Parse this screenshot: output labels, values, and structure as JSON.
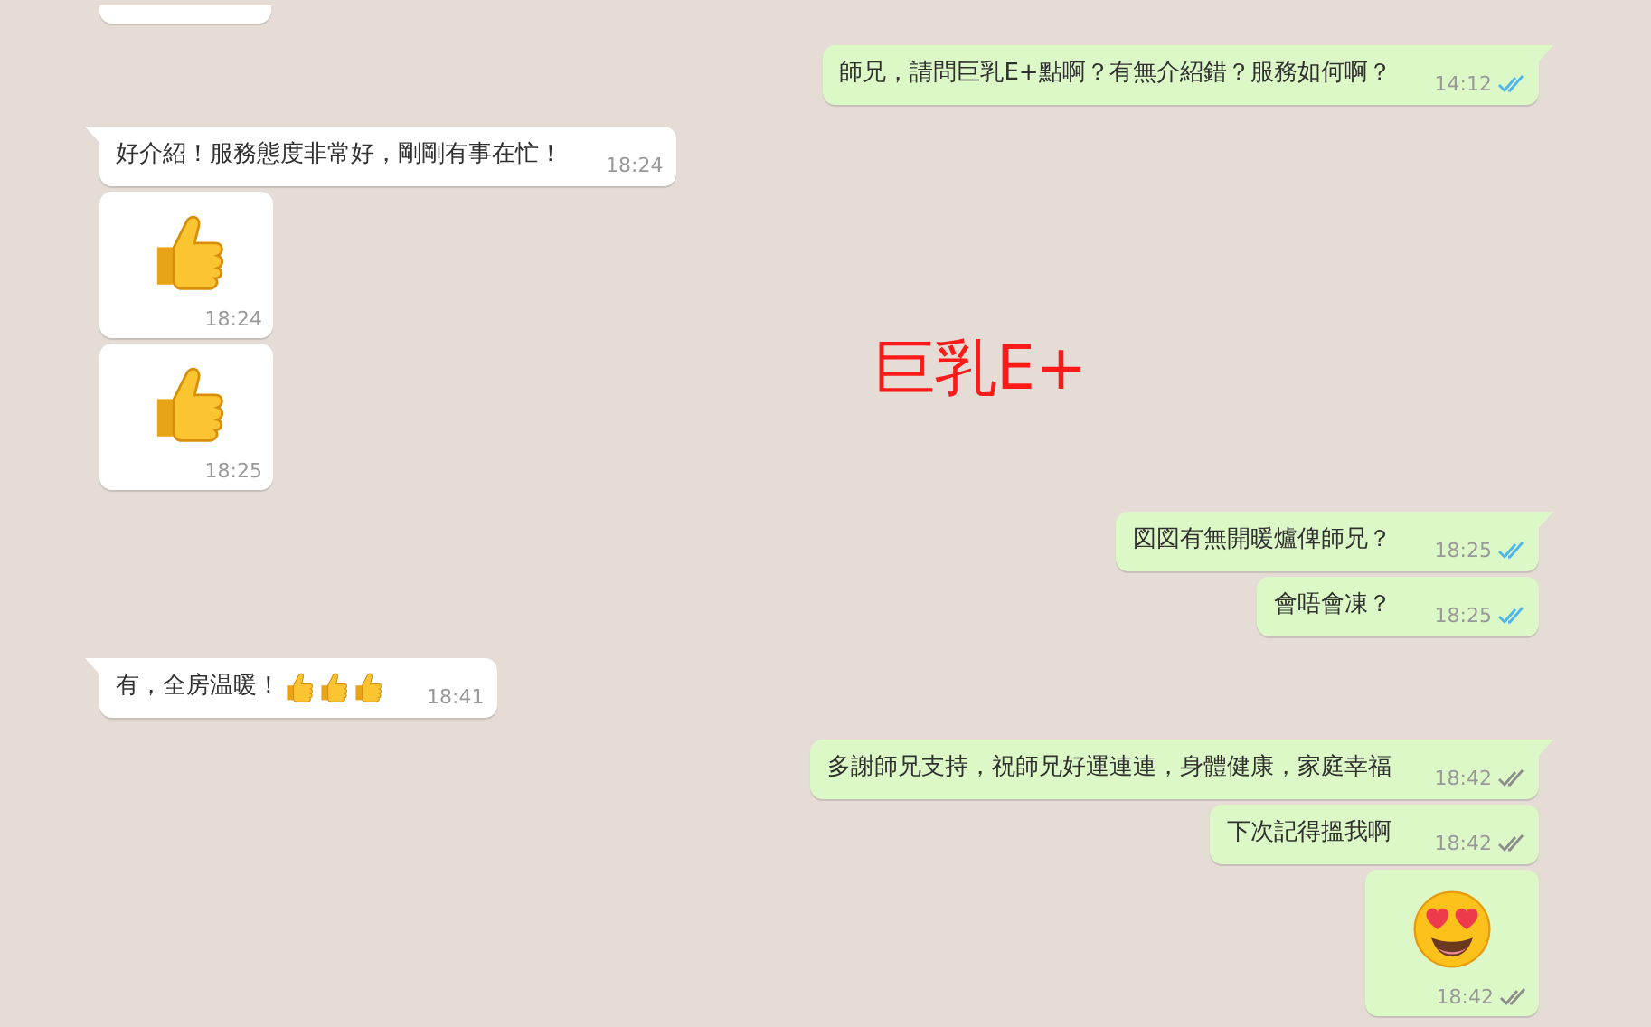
{
  "overlay_text": "巨乳E+",
  "messages": [
    {
      "outgoing": false,
      "kind": "cut"
    },
    {
      "outgoing": true,
      "kind": "text",
      "text": "師兄，請問巨乳E+點啊？有無介紹錯？服務如何啊？",
      "time": "14:12",
      "read": true
    },
    {
      "outgoing": false,
      "kind": "text",
      "text": "好介紹！服務態度非常好，剛剛有事在忙！",
      "time": "18:24"
    },
    {
      "outgoing": false,
      "kind": "thumb",
      "time": "18:24"
    },
    {
      "outgoing": false,
      "kind": "thumb",
      "time": "18:25"
    },
    {
      "outgoing": true,
      "kind": "text",
      "text": "図図有無開暖爐俾師兄？",
      "time": "18:25",
      "read": true
    },
    {
      "outgoing": true,
      "kind": "text",
      "text": "會唔會凍？",
      "time": "18:25",
      "read": true
    },
    {
      "outgoing": false,
      "kind": "text-thumbs",
      "text": "有，全房温暖！",
      "time": "18:41"
    },
    {
      "outgoing": true,
      "kind": "text",
      "text": "多謝師兄支持，祝師兄好運連連，身體健康，家庭幸福",
      "time": "18:42",
      "read": false
    },
    {
      "outgoing": true,
      "kind": "text",
      "text": "下次記得搵我啊",
      "time": "18:42",
      "read": false
    },
    {
      "outgoing": true,
      "kind": "heart-eyes",
      "time": "18:42",
      "read": false
    }
  ]
}
